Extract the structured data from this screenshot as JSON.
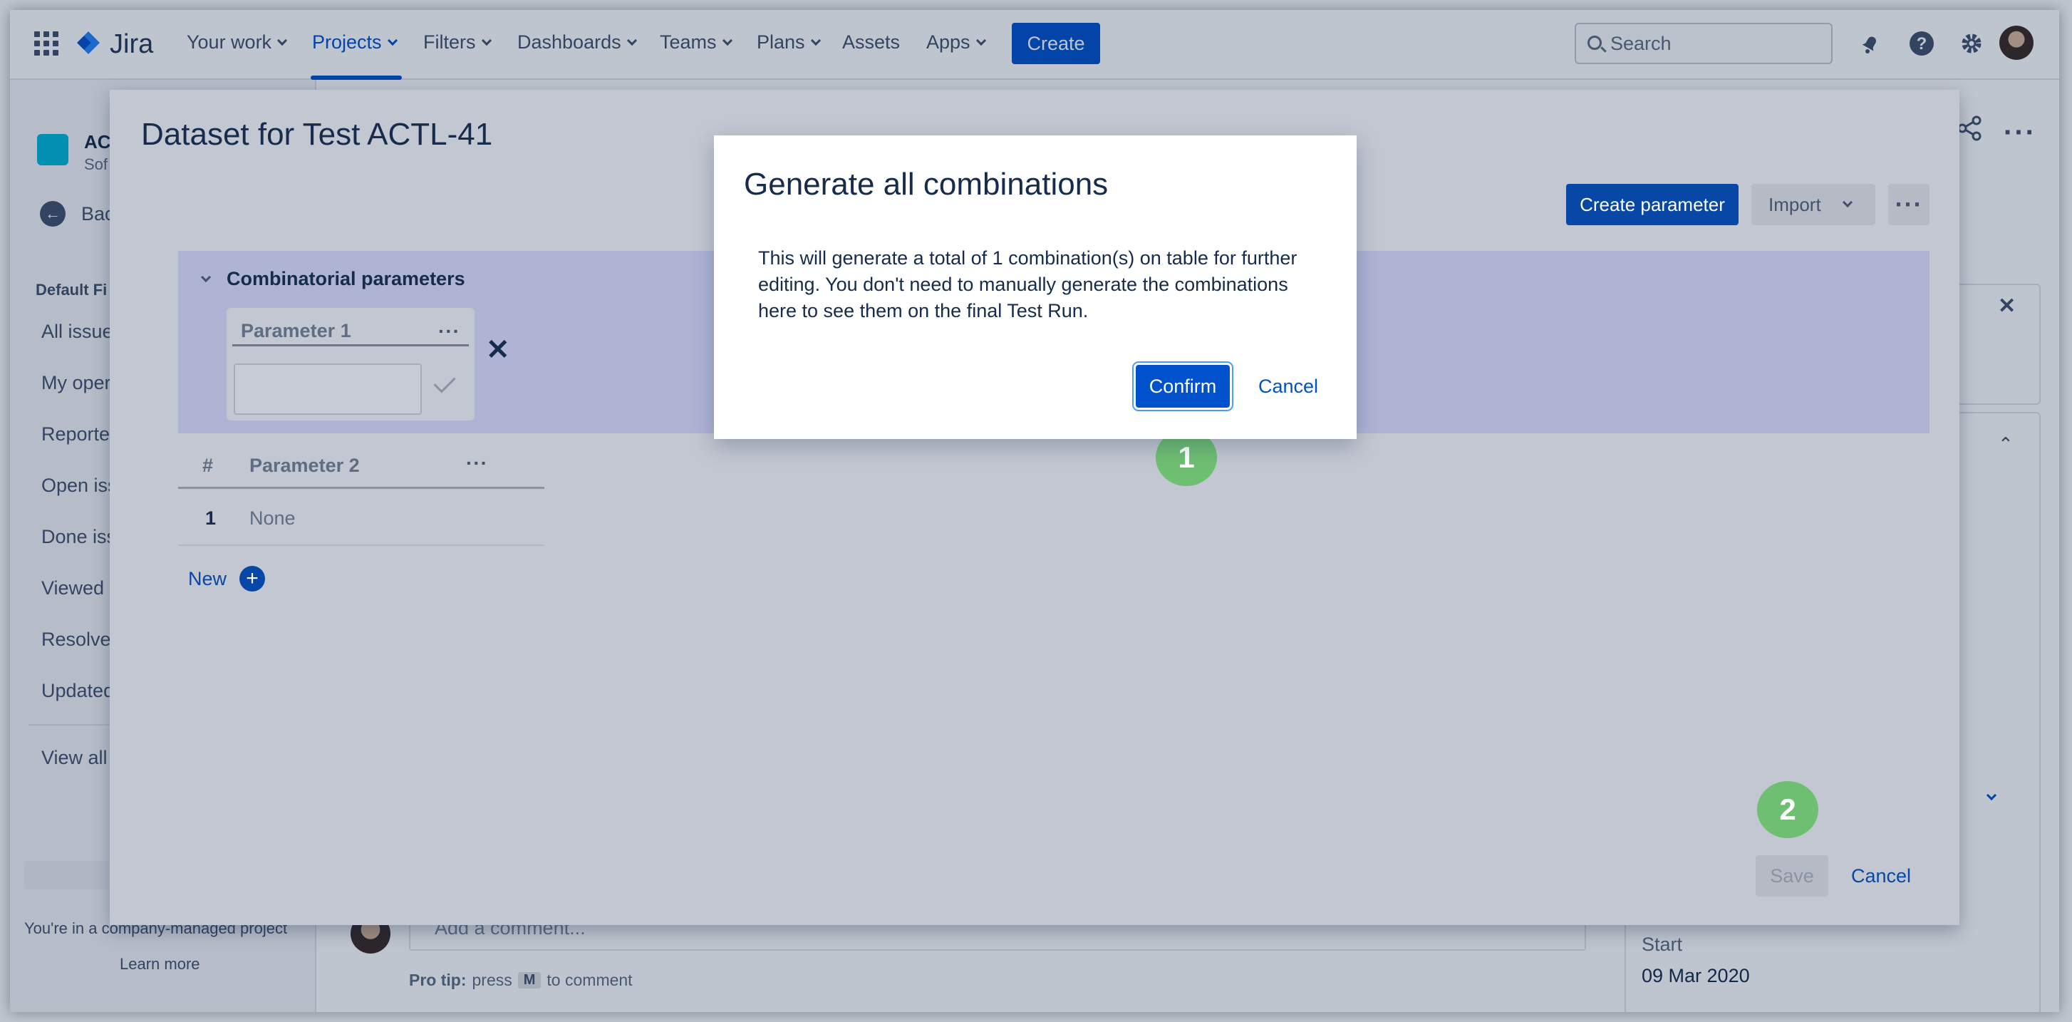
{
  "topnav": {
    "logo_text": "Jira",
    "items": [
      {
        "label": "Your work"
      },
      {
        "label": "Projects"
      },
      {
        "label": "Filters"
      },
      {
        "label": "Dashboards"
      },
      {
        "label": "Teams"
      },
      {
        "label": "Plans"
      },
      {
        "label": "Assets"
      },
      {
        "label": "Apps"
      }
    ],
    "create_label": "Create",
    "search_placeholder": "Search",
    "icons": [
      "notifications-icon",
      "help-icon",
      "settings-icon"
    ]
  },
  "sidebar": {
    "project_name": "AC",
    "project_sub": "Sof",
    "back_label": "Bac",
    "section_heading": "Default Fi",
    "items": [
      "All issue",
      "My oper",
      "Reporte",
      "Open iss",
      "Done iss",
      "Viewed r",
      "Resolved",
      "Updated"
    ],
    "view_all": "View all",
    "footer_text": "You're in a company-managed project",
    "learn_more": "Learn more"
  },
  "comment": {
    "placeholder": "Add a comment...",
    "pro_tip_label": "Pro tip:",
    "pro_tip_press": "press",
    "pro_tip_key": "M",
    "pro_tip_suffix": "to comment"
  },
  "right_panel": {
    "start_label": "Start",
    "start_value": "09 Mar 2020"
  },
  "dataset_modal": {
    "title": "Dataset for Test ACTL-41",
    "create_parameter": "Create parameter",
    "import": "Import",
    "combinatorial_heading": "Combinatorial parameters",
    "parameter1_name": "Parameter 1",
    "parameter1_value": "",
    "table": {
      "header_hash": "#",
      "header_param": "Parameter 2",
      "rows": [
        {
          "num": "1",
          "value": "None"
        }
      ]
    },
    "new_label": "New",
    "save_label": "Save",
    "cancel_label": "Cancel"
  },
  "confirm_dialog": {
    "title": "Generate all combinations",
    "body": "This will generate a total of 1 combination(s) on table for further editing. You don't need to manually generate the combinations here to see them on the final Test Run.",
    "confirm_label": "Confirm",
    "cancel_label": "Cancel"
  },
  "steps": [
    {
      "label": "1"
    },
    {
      "label": "2"
    }
  ],
  "colors": {
    "brand_blue": "#0052cc",
    "step_green": "#6fbf73",
    "combinatorial_bg": "#afb3d4"
  }
}
